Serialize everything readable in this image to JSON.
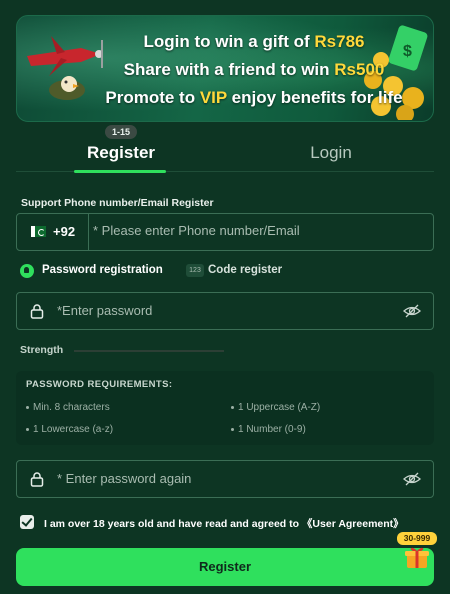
{
  "banner": {
    "line1_prefix": "Login to win a gift of ",
    "line1_amount": "Rs786",
    "line2_prefix": "Share with a friend to win ",
    "line2_amount": "Rs500",
    "line3_prefix": "Promote to ",
    "line3_vip": "VIP",
    "line3_suffix": " enjoy benefits for life"
  },
  "tabs": {
    "age_badge": "1-15",
    "register": "Register",
    "login": "Login"
  },
  "phone": {
    "label": "Support Phone number/Email Register",
    "country_code": "+92",
    "placeholder": "* Please enter Phone number/Email"
  },
  "modes": {
    "password_registration": "Password registration",
    "code_icon": "123",
    "code_register": "Code register"
  },
  "password": {
    "placeholder": "*Enter password",
    "strength_label": "Strength",
    "confirm_placeholder": "* Enter password again"
  },
  "requirements": {
    "title": "PASSWORD REQUIREMENTS:",
    "items": [
      "Min. 8 characters",
      "1 Uppercase (A-Z)",
      "1 Lowercase (a-z)",
      "1 Number (0-9)"
    ]
  },
  "agreement": {
    "checked": true,
    "text": "I am over 18 years old and have read and agreed to 《User Agreement》"
  },
  "submit": {
    "label": "Register",
    "gift_badge": "30-999"
  },
  "colors": {
    "accent": "#2fe05d",
    "background": "#0d3523",
    "highlight": "#ffd93b"
  }
}
